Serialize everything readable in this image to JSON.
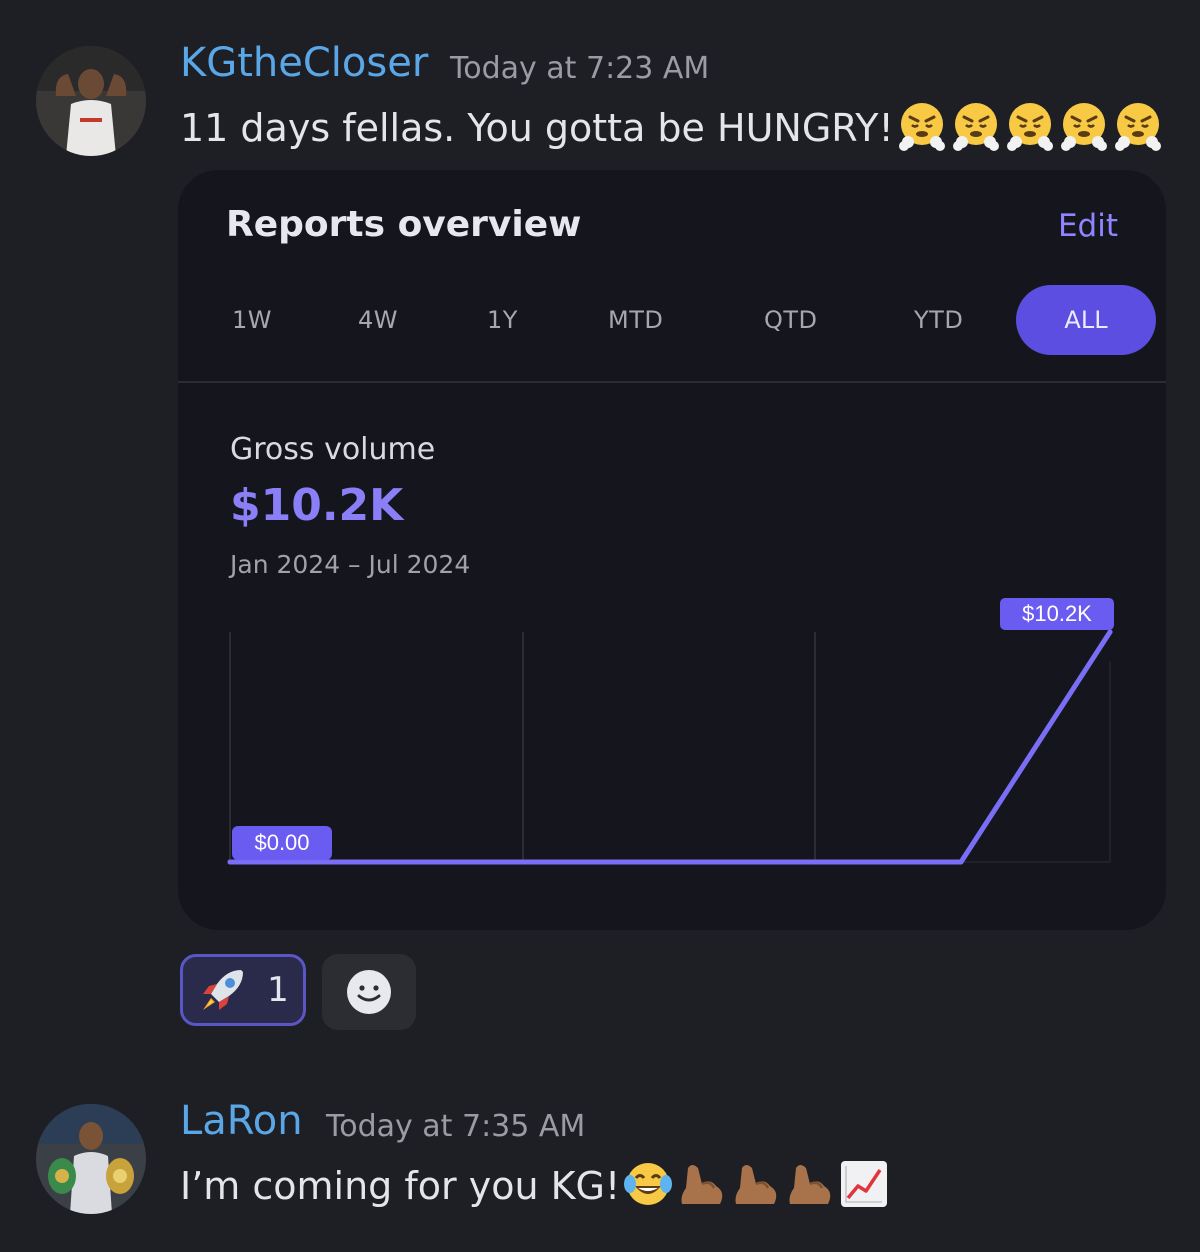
{
  "messages": [
    {
      "username": "KGtheCloser",
      "timestamp": "Today at 7:23 AM",
      "text": "11 days fellas. You gotta be HUNGRY!",
      "emojis": [
        "huffing-face",
        "huffing-face",
        "huffing-face",
        "huffing-face",
        "huffing-face"
      ]
    },
    {
      "username": "LaRon",
      "timestamp": "Today at 7:35 AM",
      "text": "I’m coming for you KG!",
      "emojis": [
        "tears-of-joy",
        "flexed-biceps",
        "flexed-biceps",
        "flexed-biceps",
        "chart-increasing"
      ]
    }
  ],
  "card": {
    "title": "Reports overview",
    "edit_label": "Edit",
    "tabs": [
      "1W",
      "4W",
      "1Y",
      "MTD",
      "QTD",
      "YTD",
      "ALL"
    ],
    "active_tab": "ALL",
    "metric_label": "Gross volume",
    "metric_value": "$10.2K",
    "date_range": "Jan 2024 – Jul 2024",
    "accent_color": "#7b6ef6"
  },
  "chart_data": {
    "type": "line",
    "x": [
      "Jan 2024",
      "Jun 2024",
      "Jul 2024"
    ],
    "y": [
      0,
      0,
      10200
    ],
    "start_label": "$0.00",
    "end_label": "$10.2K",
    "grid": true
  },
  "reactions": [
    {
      "emoji": "rocket",
      "count": "1"
    }
  ]
}
